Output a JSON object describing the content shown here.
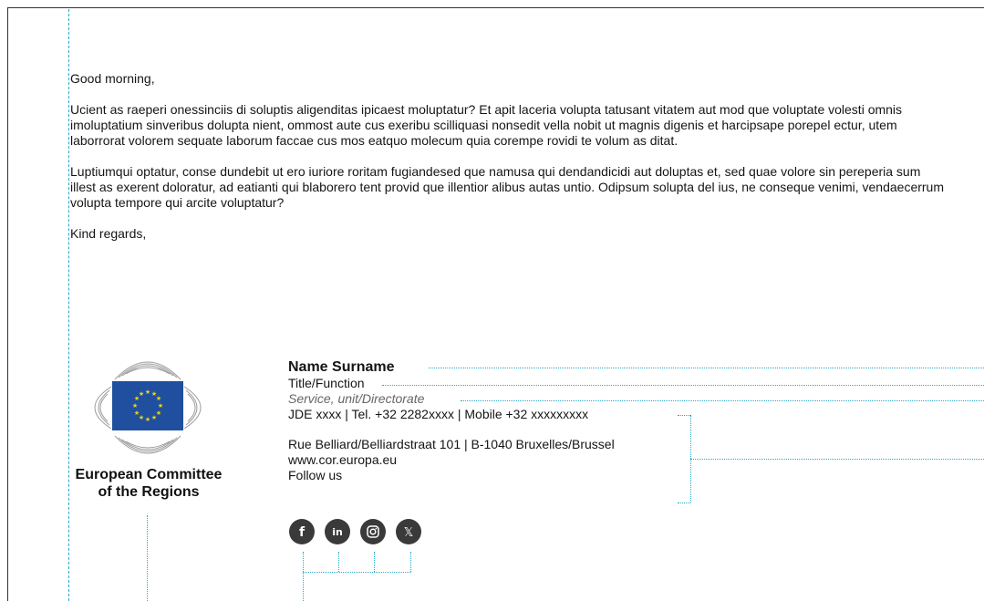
{
  "email": {
    "greeting": "Good morning,",
    "paragraphs": [
      "Ucient as raeperi onessinciis di soluptis aligenditas ipicaest moluptatur? Et apit laceria volupta tatusant vitatem aut mod que voluptate volesti omnis imoluptatium sinveribus dolupta nient, ommost aute cus exeribu scilliquasi nonsedit vella nobit ut magnis digenis et harcipsape porepel ectur, utem laborrorat volorem sequate laborum faccae cus mos eatquo molecum quia corempe rovidi te volum as ditat.",
      "Luptiumqui optatur, conse dundebit ut ero iuriore roritam fugiandesed que namusa qui dendandicidi aut doluptas et, sed quae volore sin pereperia sum illest as exerent doloratur, ad eatianti qui blaborero tent provid que illentior alibus autas untio. Odipsum solupta del ius, ne conseque venimi, vendaecerrum volupta tempore qui arcite voluptatur?"
    ],
    "closing": "Kind regards,"
  },
  "logo": {
    "line1": "European Committee",
    "line2": "of the Regions",
    "flag_color": "#1f4f9e",
    "star_color": "#f5d40a"
  },
  "signature": {
    "name": "Name Surname",
    "title": "Title/Function",
    "service": "Service, unit/Directorate",
    "contact": "JDE xxxx | Tel. +32 2282xxxx | Mobile +32 xxxxxxxxx",
    "address": "Rue Belliard/Belliardstraat 101 | B-1040 Bruxelles/Brussel",
    "website": "www.cor.europa.eu",
    "follow": "Follow us"
  },
  "social": [
    {
      "icon": "facebook-icon",
      "glyph": "f"
    },
    {
      "icon": "linkedin-icon",
      "glyph": "in"
    },
    {
      "icon": "instagram-icon",
      "glyph": ""
    },
    {
      "icon": "x-icon",
      "glyph": "𝕏"
    }
  ],
  "colors": {
    "guide": "#2aa7c9",
    "icon_bg": "#3a3a3a",
    "service_text": "#666666"
  }
}
